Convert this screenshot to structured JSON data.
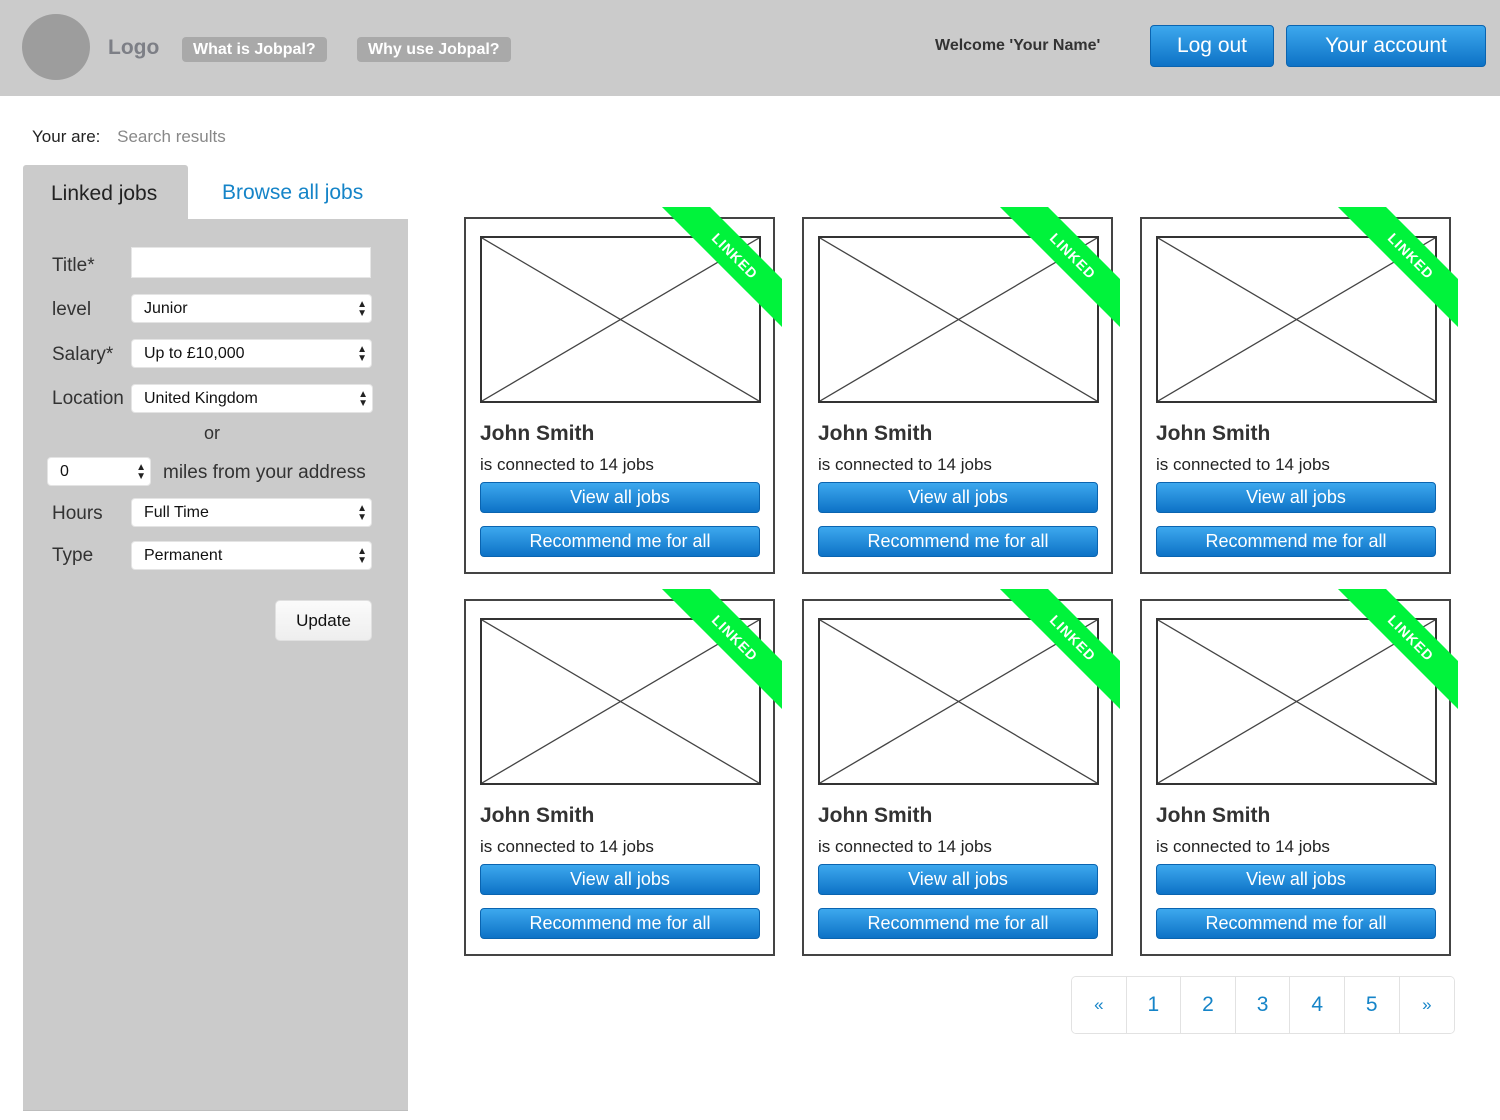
{
  "header": {
    "logo": "Logo",
    "nav": [
      {
        "label": "What is Jobpal?"
      },
      {
        "label": "Why use Jobpal?"
      }
    ],
    "welcome": "Welcome 'Your Name'",
    "logout_label": "Log out",
    "account_label": "Your account"
  },
  "breadcrumb": {
    "label": "Your are:",
    "current": "Search results"
  },
  "tabs": {
    "linked": "Linked jobs",
    "browse": "Browse all jobs"
  },
  "filters": {
    "title_label": "Title*",
    "title_value": "",
    "level_label": "level",
    "level_value": "Junior",
    "salary_label": "Salary*",
    "salary_value": "Up to £10,000",
    "location_label": "Location",
    "location_value": "United Kingdom",
    "or_label": "or",
    "miles_value": "0",
    "miles_label": "miles from your address",
    "hours_label": "Hours",
    "hours_value": "Full Time",
    "type_label": "Type",
    "type_value": "Permanent",
    "update_label": "Update"
  },
  "cards": [
    {
      "ribbon": "LINKED",
      "name": "John Smith",
      "connected": "is connected to 14 jobs",
      "view_label": "View all jobs",
      "recommend_label": "Recommend me for all"
    },
    {
      "ribbon": "LINKED",
      "name": "John Smith",
      "connected": "is connected to 14 jobs",
      "view_label": "View all jobs",
      "recommend_label": "Recommend me for all"
    },
    {
      "ribbon": "LINKED",
      "name": "John Smith",
      "connected": "is connected to 14 jobs",
      "view_label": "View all jobs",
      "recommend_label": "Recommend me for all"
    },
    {
      "ribbon": "LINKED",
      "name": "John Smith",
      "connected": "is connected to 14 jobs",
      "view_label": "View all jobs",
      "recommend_label": "Recommend me for all"
    },
    {
      "ribbon": "LINKED",
      "name": "John Smith",
      "connected": "is connected to 14 jobs",
      "view_label": "View all jobs",
      "recommend_label": "Recommend me for all"
    },
    {
      "ribbon": "LINKED",
      "name": "John Smith",
      "connected": "is connected to 14 jobs",
      "view_label": "View all jobs",
      "recommend_label": "Recommend me for all"
    }
  ],
  "pagination": {
    "prev": "«",
    "pages": [
      "1",
      "2",
      "3",
      "4",
      "5"
    ],
    "next": "»"
  },
  "colors": {
    "accent_blue": "#1584c8",
    "ribbon_green": "#00f33b",
    "header_gray": "#cbcbcb"
  }
}
